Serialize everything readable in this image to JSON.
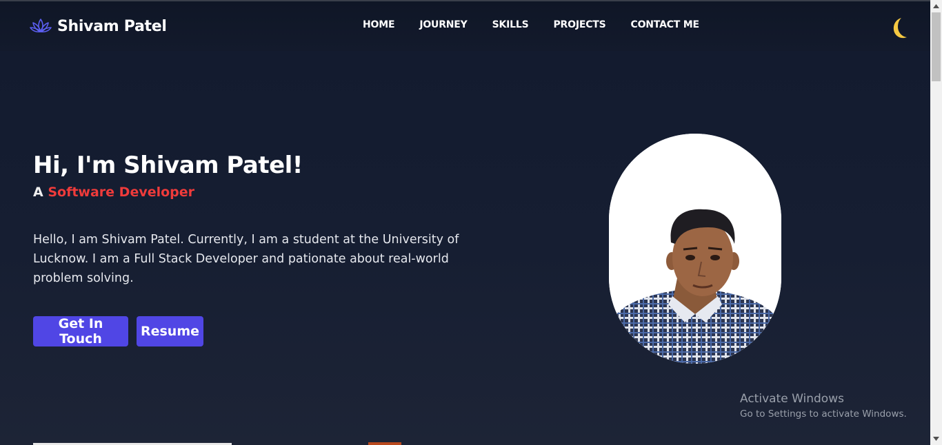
{
  "navbar": {
    "brand_name": "Shivam Patel",
    "logo_icon": "lotus-icon",
    "links": [
      "HOME",
      "JOURNEY",
      "SKILLS",
      "PROJECTS",
      "CONTACT ME"
    ],
    "theme_icon": "moon-icon"
  },
  "hero": {
    "title": "Hi, I'm Shivam Patel!",
    "subtitle_prefix": "A",
    "subtitle_role": "Software Developer",
    "description": "Hello, I am Shivam Patel. Currently, I am a student at the University of Lucknow. I am a Full Stack Developer and pationate about real-world problem solving.",
    "buttons": {
      "contact": "Get In Touch",
      "resume": "Resume"
    }
  },
  "watermark": {
    "title": "Activate Windows",
    "subtitle": "Go to Settings to activate Windows."
  },
  "colors": {
    "background": "#141b2f",
    "accent_button": "#5046e5",
    "role_text": "#ef3b3b",
    "moon": "#f5c842",
    "logo": "#5b5ef0"
  }
}
